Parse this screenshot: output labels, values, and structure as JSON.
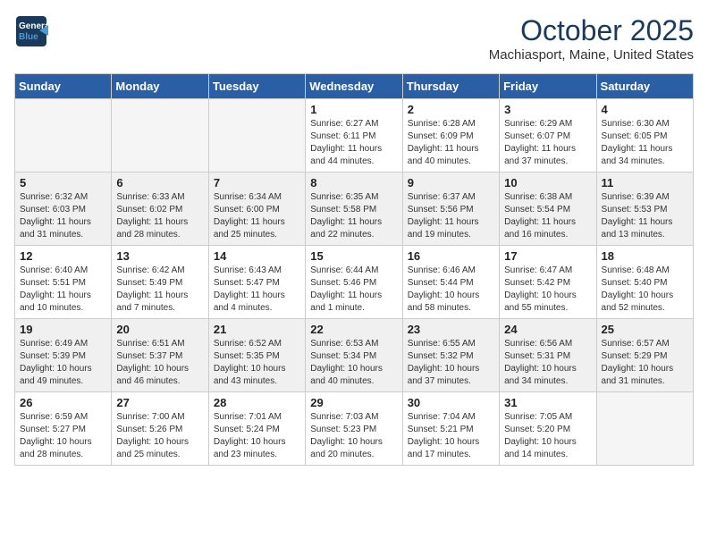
{
  "header": {
    "logo_line1": "General",
    "logo_line2": "Blue",
    "month": "October 2025",
    "location": "Machiasport, Maine, United States"
  },
  "weekdays": [
    "Sunday",
    "Monday",
    "Tuesday",
    "Wednesday",
    "Thursday",
    "Friday",
    "Saturday"
  ],
  "weeks": [
    [
      {
        "day": "",
        "info": ""
      },
      {
        "day": "",
        "info": ""
      },
      {
        "day": "",
        "info": ""
      },
      {
        "day": "1",
        "info": "Sunrise: 6:27 AM\nSunset: 6:11 PM\nDaylight: 11 hours\nand 44 minutes."
      },
      {
        "day": "2",
        "info": "Sunrise: 6:28 AM\nSunset: 6:09 PM\nDaylight: 11 hours\nand 40 minutes."
      },
      {
        "day": "3",
        "info": "Sunrise: 6:29 AM\nSunset: 6:07 PM\nDaylight: 11 hours\nand 37 minutes."
      },
      {
        "day": "4",
        "info": "Sunrise: 6:30 AM\nSunset: 6:05 PM\nDaylight: 11 hours\nand 34 minutes."
      }
    ],
    [
      {
        "day": "5",
        "info": "Sunrise: 6:32 AM\nSunset: 6:03 PM\nDaylight: 11 hours\nand 31 minutes."
      },
      {
        "day": "6",
        "info": "Sunrise: 6:33 AM\nSunset: 6:02 PM\nDaylight: 11 hours\nand 28 minutes."
      },
      {
        "day": "7",
        "info": "Sunrise: 6:34 AM\nSunset: 6:00 PM\nDaylight: 11 hours\nand 25 minutes."
      },
      {
        "day": "8",
        "info": "Sunrise: 6:35 AM\nSunset: 5:58 PM\nDaylight: 11 hours\nand 22 minutes."
      },
      {
        "day": "9",
        "info": "Sunrise: 6:37 AM\nSunset: 5:56 PM\nDaylight: 11 hours\nand 19 minutes."
      },
      {
        "day": "10",
        "info": "Sunrise: 6:38 AM\nSunset: 5:54 PM\nDaylight: 11 hours\nand 16 minutes."
      },
      {
        "day": "11",
        "info": "Sunrise: 6:39 AM\nSunset: 5:53 PM\nDaylight: 11 hours\nand 13 minutes."
      }
    ],
    [
      {
        "day": "12",
        "info": "Sunrise: 6:40 AM\nSunset: 5:51 PM\nDaylight: 11 hours\nand 10 minutes."
      },
      {
        "day": "13",
        "info": "Sunrise: 6:42 AM\nSunset: 5:49 PM\nDaylight: 11 hours\nand 7 minutes."
      },
      {
        "day": "14",
        "info": "Sunrise: 6:43 AM\nSunset: 5:47 PM\nDaylight: 11 hours\nand 4 minutes."
      },
      {
        "day": "15",
        "info": "Sunrise: 6:44 AM\nSunset: 5:46 PM\nDaylight: 11 hours\nand 1 minute."
      },
      {
        "day": "16",
        "info": "Sunrise: 6:46 AM\nSunset: 5:44 PM\nDaylight: 10 hours\nand 58 minutes."
      },
      {
        "day": "17",
        "info": "Sunrise: 6:47 AM\nSunset: 5:42 PM\nDaylight: 10 hours\nand 55 minutes."
      },
      {
        "day": "18",
        "info": "Sunrise: 6:48 AM\nSunset: 5:40 PM\nDaylight: 10 hours\nand 52 minutes."
      }
    ],
    [
      {
        "day": "19",
        "info": "Sunrise: 6:49 AM\nSunset: 5:39 PM\nDaylight: 10 hours\nand 49 minutes."
      },
      {
        "day": "20",
        "info": "Sunrise: 6:51 AM\nSunset: 5:37 PM\nDaylight: 10 hours\nand 46 minutes."
      },
      {
        "day": "21",
        "info": "Sunrise: 6:52 AM\nSunset: 5:35 PM\nDaylight: 10 hours\nand 43 minutes."
      },
      {
        "day": "22",
        "info": "Sunrise: 6:53 AM\nSunset: 5:34 PM\nDaylight: 10 hours\nand 40 minutes."
      },
      {
        "day": "23",
        "info": "Sunrise: 6:55 AM\nSunset: 5:32 PM\nDaylight: 10 hours\nand 37 minutes."
      },
      {
        "day": "24",
        "info": "Sunrise: 6:56 AM\nSunset: 5:31 PM\nDaylight: 10 hours\nand 34 minutes."
      },
      {
        "day": "25",
        "info": "Sunrise: 6:57 AM\nSunset: 5:29 PM\nDaylight: 10 hours\nand 31 minutes."
      }
    ],
    [
      {
        "day": "26",
        "info": "Sunrise: 6:59 AM\nSunset: 5:27 PM\nDaylight: 10 hours\nand 28 minutes."
      },
      {
        "day": "27",
        "info": "Sunrise: 7:00 AM\nSunset: 5:26 PM\nDaylight: 10 hours\nand 25 minutes."
      },
      {
        "day": "28",
        "info": "Sunrise: 7:01 AM\nSunset: 5:24 PM\nDaylight: 10 hours\nand 23 minutes."
      },
      {
        "day": "29",
        "info": "Sunrise: 7:03 AM\nSunset: 5:23 PM\nDaylight: 10 hours\nand 20 minutes."
      },
      {
        "day": "30",
        "info": "Sunrise: 7:04 AM\nSunset: 5:21 PM\nDaylight: 10 hours\nand 17 minutes."
      },
      {
        "day": "31",
        "info": "Sunrise: 7:05 AM\nSunset: 5:20 PM\nDaylight: 10 hours\nand 14 minutes."
      },
      {
        "day": "",
        "info": ""
      }
    ]
  ]
}
